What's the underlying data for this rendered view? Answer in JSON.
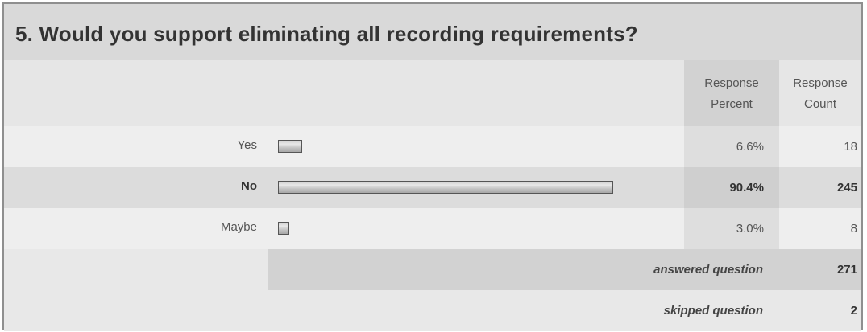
{
  "question": {
    "title": "5. Would you support eliminating all recording requirements?"
  },
  "table": {
    "header_percent_line1": "Response",
    "header_percent_line2": "Percent",
    "header_count_line1": "Response",
    "header_count_line2": "Count",
    "rows": [
      {
        "label": "Yes",
        "percent": "6.6%",
        "count": "18"
      },
      {
        "label": "No",
        "percent": "90.4%",
        "count": "245"
      },
      {
        "label": "Maybe",
        "percent": "3.0%",
        "count": "8"
      }
    ],
    "answered_label": "answered question",
    "answered_value": "271",
    "skipped_label": "skipped question",
    "skipped_value": "2"
  },
  "chart_data": {
    "type": "bar",
    "orientation": "horizontal",
    "title": "5. Would you support eliminating all recording requirements?",
    "categories": [
      "Yes",
      "No",
      "Maybe"
    ],
    "values": [
      6.6,
      90.4,
      3.0
    ],
    "counts": [
      18,
      245,
      8
    ],
    "xlim": [
      0,
      100
    ],
    "grid": false,
    "colors": {
      "bar": "#c8c8c8",
      "bar_border": "#555555",
      "highlight_row": "#d2d2d2"
    }
  }
}
